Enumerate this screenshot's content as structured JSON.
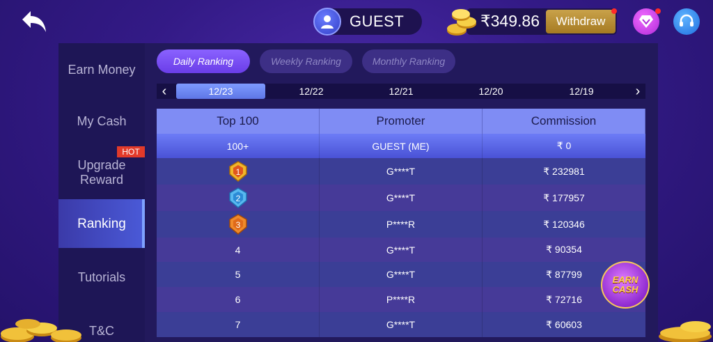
{
  "header": {
    "guest_label": "GUEST",
    "balance": "₹349.86",
    "withdraw_label": "Withdraw"
  },
  "sidebar": {
    "items": [
      {
        "label": "Earn Money"
      },
      {
        "label": "My Cash"
      },
      {
        "label": "Upgrade\nReward"
      },
      {
        "label": "Ranking"
      },
      {
        "label": "Tutorials"
      },
      {
        "label": "T&C"
      }
    ],
    "hot_badge": "HOT"
  },
  "tabs": [
    {
      "label": "Daily Ranking"
    },
    {
      "label": "Weekly Ranking"
    },
    {
      "label": "Monthly Ranking"
    }
  ],
  "dates": [
    "12/23",
    "12/22",
    "12/21",
    "12/20",
    "12/19"
  ],
  "table": {
    "headers": [
      "Top 100",
      "Promoter",
      "Commission"
    ],
    "me_row": {
      "rank": "100+",
      "promoter": "GUEST (ME)",
      "commission": "₹ 0"
    },
    "rows": [
      {
        "rank": "1",
        "promoter": "G****T",
        "commission": "₹ 232981"
      },
      {
        "rank": "2",
        "promoter": "G****T",
        "commission": "₹ 177957"
      },
      {
        "rank": "3",
        "promoter": "P****R",
        "commission": "₹ 120346"
      },
      {
        "rank": "4",
        "promoter": "G****T",
        "commission": "₹ 90354"
      },
      {
        "rank": "5",
        "promoter": "G****T",
        "commission": "₹ 87799"
      },
      {
        "rank": "6",
        "promoter": "P****R",
        "commission": "₹ 72716"
      },
      {
        "rank": "7",
        "promoter": "G****T",
        "commission": "₹ 60603"
      }
    ]
  },
  "earn_cash": {
    "line1": "EARN",
    "line2": "CASH"
  },
  "colors": {
    "gold": "#f1b62a",
    "silver_blue": "#58b8f0",
    "bronze": "#f08a2a",
    "accent": "#6a3de8"
  }
}
